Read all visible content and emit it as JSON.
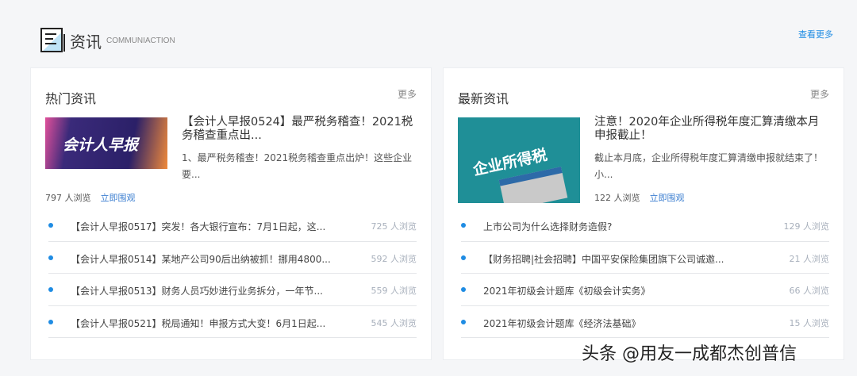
{
  "header": {
    "title": "资讯",
    "subtitle": "COMMUNIACTION",
    "more": "查看更多"
  },
  "hot": {
    "title": "热门资讯",
    "more": "更多",
    "featured": {
      "image_text": "会计人早报",
      "title": "【会计人早报0524】最严税务稽查！2021税务稽查重点出...",
      "desc": "1、最严税务稽查！2021税务稽查重点出炉！这些企业要...",
      "views": "797 人浏览",
      "action": "立即围观"
    },
    "items": [
      {
        "title": "【会计人早报0517】突发！各大银行宣布：7月1日起，这...",
        "views": "725 人浏览"
      },
      {
        "title": "【会计人早报0514】某地产公司90后出纳被抓！挪用4800...",
        "views": "592 人浏览"
      },
      {
        "title": "【会计人早报0513】财务人员巧妙进行业务拆分，一年节...",
        "views": "559 人浏览"
      },
      {
        "title": "【会计人早报0521】税局通知！申报方式大变！6月1日起...",
        "views": "545 人浏览"
      }
    ]
  },
  "latest": {
    "title": "最新资讯",
    "more": "更多",
    "featured": {
      "image_text": "企业所得税",
      "title": "注意！2020年企业所得税年度汇算清缴本月申报截止！",
      "desc": "截止本月底，企业所得税年度汇算清缴申报就结束了！小...",
      "views": "122 人浏览",
      "action": "立即围观"
    },
    "items": [
      {
        "title": "上市公司为什么选择财务造假?",
        "views": "129 人浏览"
      },
      {
        "title": "【财务招聘|社会招聘】中国平安保险集团旗下公司诚邀...",
        "views": "21 人浏览"
      },
      {
        "title": "2021年初级会计题库《初级会计实务》",
        "views": "66 人浏览"
      },
      {
        "title": "2021年初级会计题库《经济法基础》",
        "views": "15 人浏览"
      }
    ]
  },
  "watermark": "头条 @用友一成都杰创普信"
}
